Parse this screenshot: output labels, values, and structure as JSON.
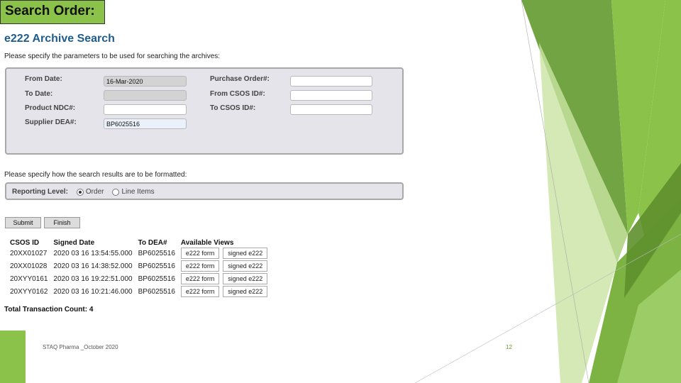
{
  "slide": {
    "title": "Search Order:",
    "footer": "STAQ Pharma _October 2020",
    "page_number": "12"
  },
  "search": {
    "heading": "e222 Archive Search",
    "instructions": "Please specify the parameters to be used for searching the archives:",
    "fields": {
      "from_date": {
        "label": "From Date:",
        "value": "16-Mar-2020"
      },
      "to_date": {
        "label": "To Date:",
        "value": ""
      },
      "product_ndc": {
        "label": "Product NDC#:",
        "value": ""
      },
      "supplier_dea": {
        "label": "Supplier DEA#:",
        "value": "BP6025516"
      },
      "purchase_order": {
        "label": "Purchase Order#:",
        "value": ""
      },
      "from_csos_id": {
        "label": "From CSOS ID#:",
        "value": ""
      },
      "to_csos_id": {
        "label": "To CSOS ID#:",
        "value": ""
      }
    },
    "format_instructions": "Please specify how the search results are to be formatted:",
    "reporting_level": {
      "label": "Reporting Level:",
      "options": [
        "Order",
        "Line Items"
      ],
      "selected": "Order"
    },
    "buttons": {
      "submit": "Submit",
      "finish": "Finish"
    }
  },
  "results": {
    "headers": [
      "CSOS ID",
      "Signed Date",
      "To DEA#",
      "Available Views"
    ],
    "rows": [
      {
        "csos_id": "20XX01027",
        "signed_date": "2020 03 16 13:54:55.000",
        "to_dea": "BP6025516",
        "view1": "e222 form",
        "view2": "signed e222"
      },
      {
        "csos_id": "20XX01028",
        "signed_date": "2020 03 16 14:38:52.000",
        "to_dea": "BP6025516",
        "view1": "e222 form",
        "view2": "signed e222"
      },
      {
        "csos_id": "20XYY0161",
        "signed_date": "2020 03 16 19:22:51.000",
        "to_dea": "BP6025516",
        "view1": "e222 form",
        "view2": "signed e222"
      },
      {
        "csos_id": "20XYY0162",
        "signed_date": "2020 03 16 10:21:46.000",
        "to_dea": "BP6025516",
        "view1": "e222 form",
        "view2": "signed e222"
      }
    ],
    "total": "Total Transaction Count: 4"
  },
  "colors": {
    "accent_green": "#8bc34a",
    "heading_blue": "#1f5c8b"
  }
}
